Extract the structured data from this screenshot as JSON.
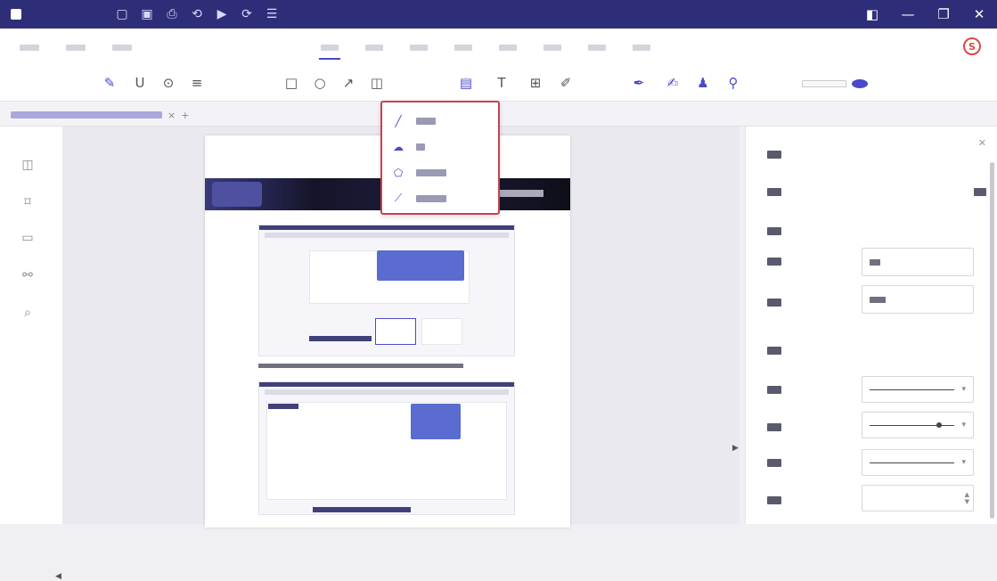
{
  "titlebar": {
    "app_title": "",
    "quick_actions": [
      "folder-icon",
      "save-icon",
      "print-icon",
      "undo-icon",
      "play-icon",
      "redo-icon",
      "menu-icon"
    ],
    "window_controls": [
      "minimize-icon",
      "restore-icon",
      "close-icon"
    ]
  },
  "menubar": {
    "left_items": [
      "",
      "",
      ""
    ],
    "tabs": [
      "",
      "",
      "",
      "",
      "",
      "",
      "",
      "",
      ""
    ],
    "active_tab_index": 0
  },
  "toolbar": {
    "tools": [
      "highlight-icon",
      "underline-icon",
      "stamp-icon",
      "strikeout-icon",
      "rectangle-icon",
      "ellipse-icon",
      "arrow-icon",
      "shape-dropdown-icon",
      "note-icon",
      "text-icon",
      "textbox-icon",
      "pencil-icon",
      "eraser-icon",
      "signature-icon",
      "person-icon",
      "measure-icon"
    ],
    "color_label": ""
  },
  "tab": {
    "title": "",
    "close": "×",
    "add": "+"
  },
  "left_rail": [
    "thumbnail-icon",
    "bookmark-icon",
    "comment-icon",
    "attachment-icon",
    "search-icon"
  ],
  "dropdown": {
    "items": [
      {
        "icon": "line-icon",
        "label": ""
      },
      {
        "icon": "cloud-icon",
        "label": ""
      },
      {
        "icon": "polygon-icon",
        "label": ""
      },
      {
        "icon": "polyline-icon",
        "label": ""
      }
    ]
  },
  "props": {
    "title": "",
    "type_label": "",
    "type_value": "",
    "section_general": "",
    "author_label": "",
    "author_value": "",
    "subject_label": "",
    "subject_value": "",
    "section_style": "",
    "style_rows": [
      "",
      "",
      ""
    ],
    "opacity_label": "",
    "opacity_value": ""
  },
  "colors": {
    "titlebar": "#2e2e78",
    "accent": "#4a4ac8",
    "dropdown_border": "#c8424a"
  }
}
